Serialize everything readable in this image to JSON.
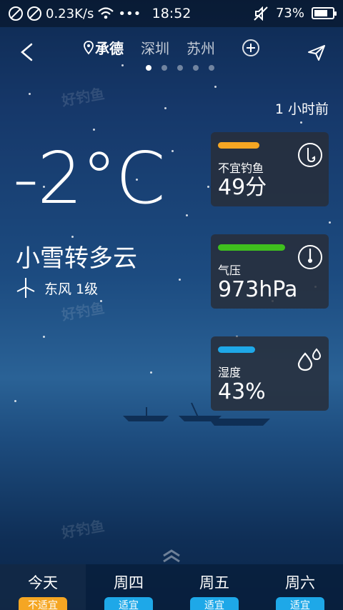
{
  "statusbar": {
    "speed": "0.23K/s",
    "more": "•••",
    "time": "18:52",
    "battery": "73%",
    "battery_level": 0.73,
    "icons": [
      "no-sim-icon",
      "no-sim-icon",
      "wifi-icon",
      "mute-icon",
      "battery-icon"
    ]
  },
  "nav": {
    "cities": [
      "承德",
      "深圳",
      "苏州"
    ],
    "active_city": "承德",
    "page_count": 5,
    "active_page": 1
  },
  "weather": {
    "updated": "1 小时前",
    "temperature": "-2°C",
    "condition": "小雪转多云",
    "wind": "东风 1级"
  },
  "cards": [
    {
      "bar_color": "#f5a623",
      "label": "不宜钓鱼",
      "value": "49分",
      "icon": "fishing-hook-icon"
    },
    {
      "bar_color": "#3fc01e",
      "label": "气压",
      "value": "973hPa",
      "icon": "gauge-icon"
    },
    {
      "bar_color": "#1ea8e8",
      "label": "湿度",
      "value": "43%",
      "icon": "water-drops-icon"
    }
  ],
  "tabs": [
    {
      "label": "今天",
      "badge": "不适宜",
      "badge_color": "#f5a623"
    },
    {
      "label": "周四",
      "badge": "适宜",
      "badge_color": "#1ea8e8"
    },
    {
      "label": "周五",
      "badge": "适宜",
      "badge_color": "#1ea8e8"
    },
    {
      "label": "周六",
      "badge": "适宜",
      "badge_color": "#1ea8e8"
    }
  ]
}
